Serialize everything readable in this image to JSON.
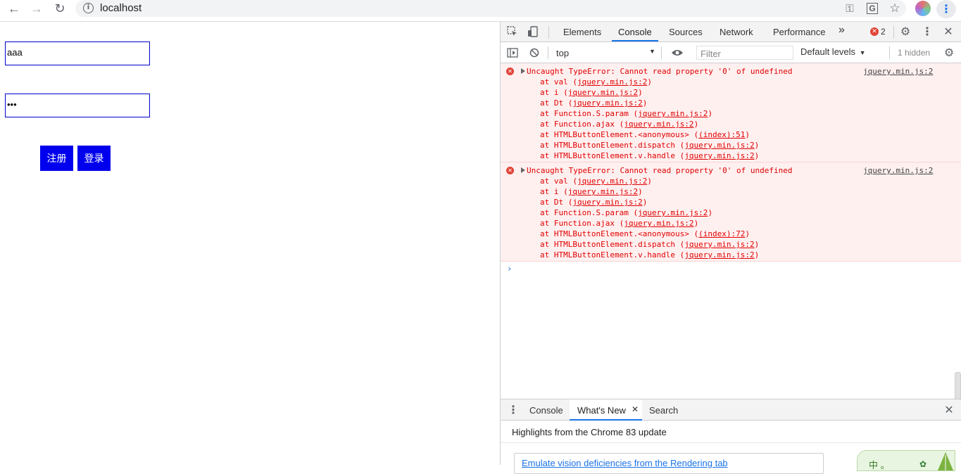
{
  "browser": {
    "url": "localhost",
    "back_glyph": "←",
    "forward_glyph": "→",
    "reload_glyph": "↻",
    "info_glyph": "i",
    "key_glyph": "⚿",
    "translate_glyph": "G",
    "star_glyph": "☆",
    "menu_glyph": "⋮",
    "icons": [
      "back-icon",
      "forward-icon",
      "reload-icon",
      "info-icon",
      "key-icon",
      "translate-icon",
      "star-icon",
      "profile-avatar",
      "menu-icon"
    ]
  },
  "page": {
    "username_value": "aaa",
    "password_value": "•••",
    "register_label": "注册",
    "login_label": "登录",
    "button_color": "#0000ee"
  },
  "devtools": {
    "tabs": [
      "Elements",
      "Console",
      "Sources",
      "Network",
      "Performance"
    ],
    "active_tab": "Console",
    "more_tabs_glyph": "»",
    "error_count": "2",
    "toolbar": {
      "context": "top",
      "filter_placeholder": "Filter",
      "levels": "Default levels",
      "hidden": "1 hidden"
    },
    "errors": [
      {
        "message": "Uncaught TypeError: Cannot read property '0' of undefined",
        "source": "jquery.min.js:2",
        "stack": [
          {
            "fn": "at val",
            "loc": "jquery.min.js:2"
          },
          {
            "fn": "at i",
            "loc": "jquery.min.js:2"
          },
          {
            "fn": "at Dt",
            "loc": "jquery.min.js:2"
          },
          {
            "fn": "at Function.S.param",
            "loc": "jquery.min.js:2"
          },
          {
            "fn": "at Function.ajax",
            "loc": "jquery.min.js:2"
          },
          {
            "fn": "at HTMLButtonElement.<anonymous>",
            "loc": "(index):51"
          },
          {
            "fn": "at HTMLButtonElement.dispatch",
            "loc": "jquery.min.js:2"
          },
          {
            "fn": "at HTMLButtonElement.v.handle",
            "loc": "jquery.min.js:2"
          }
        ]
      },
      {
        "message": "Uncaught TypeError: Cannot read property '0' of undefined",
        "source": "jquery.min.js:2",
        "stack": [
          {
            "fn": "at val",
            "loc": "jquery.min.js:2"
          },
          {
            "fn": "at i",
            "loc": "jquery.min.js:2"
          },
          {
            "fn": "at Dt",
            "loc": "jquery.min.js:2"
          },
          {
            "fn": "at Function.S.param",
            "loc": "jquery.min.js:2"
          },
          {
            "fn": "at Function.ajax",
            "loc": "jquery.min.js:2"
          },
          {
            "fn": "at HTMLButtonElement.<anonymous>",
            "loc": "(index):72"
          },
          {
            "fn": "at HTMLButtonElement.dispatch",
            "loc": "jquery.min.js:2"
          },
          {
            "fn": "at HTMLButtonElement.v.handle",
            "loc": "jquery.min.js:2"
          }
        ]
      }
    ],
    "prompt_glyph": "›",
    "drawer": {
      "tabs": [
        "Console",
        "What's New",
        "Search"
      ],
      "active_tab": "What's New",
      "headline": "Highlights from the Chrome 83 update",
      "card_link": "Emulate vision deficiencies from the Rendering tab",
      "promo_text": "中 。"
    },
    "colors": {
      "error_text": "#e00000",
      "error_bg": "#fff0f0",
      "accent": "#1a73e8"
    }
  }
}
